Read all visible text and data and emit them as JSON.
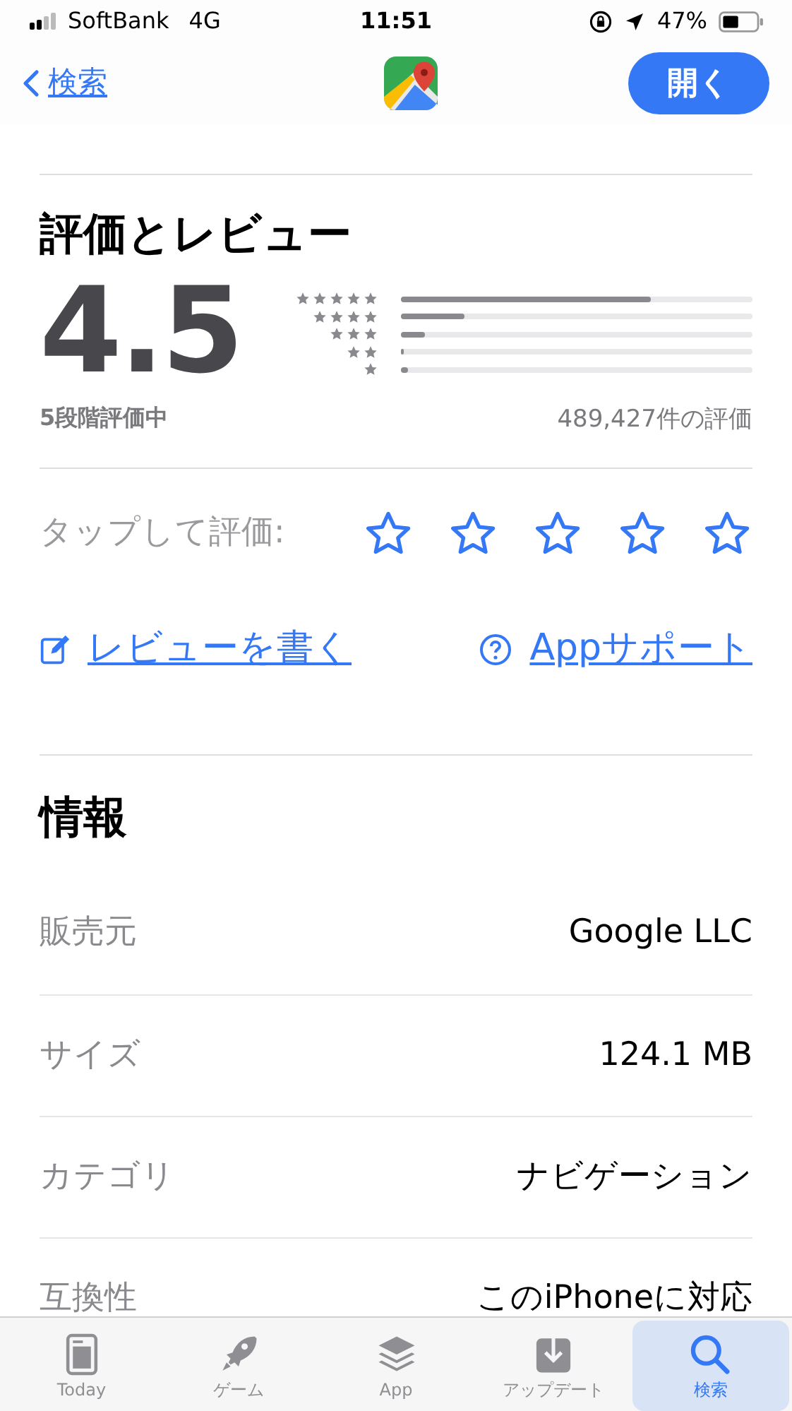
{
  "status_bar": {
    "carrier": "SoftBank",
    "network": "4G",
    "time": "11:51",
    "battery": "47%"
  },
  "nav": {
    "back": "検索",
    "open_button": "開く"
  },
  "ratings": {
    "heading": "評価とレビュー",
    "score": "4.5",
    "out_of": "5段階評価中",
    "count": "489,427件の評価",
    "bars": [
      {
        "level": 0.71
      },
      {
        "level": 0.18
      },
      {
        "level": 0.07
      },
      {
        "level": 0.01
      },
      {
        "level": 0.02
      }
    ],
    "tap_label": "タップして評価:"
  },
  "links": [
    {
      "kind": "write",
      "label": "レビューを書く"
    },
    {
      "kind": "support",
      "label": "Appサポート"
    }
  ],
  "info": {
    "heading": "情報",
    "rows": [
      {
        "label": "販売元",
        "value": "Google LLC"
      },
      {
        "label": "サイズ",
        "value": "124.1 MB"
      },
      {
        "label": "カテゴリ",
        "value": "ナビゲーション"
      },
      {
        "label": "互換性",
        "value": "このiPhoneに対応"
      }
    ]
  },
  "tabs": [
    {
      "kind": "today",
      "label": "Today",
      "selected": false
    },
    {
      "kind": "games",
      "label": "ゲーム",
      "selected": false
    },
    {
      "kind": "apps",
      "label": "App",
      "selected": false
    },
    {
      "kind": "updates",
      "label": "アップデート",
      "selected": false
    },
    {
      "kind": "search",
      "label": "検索",
      "selected": true
    }
  ]
}
